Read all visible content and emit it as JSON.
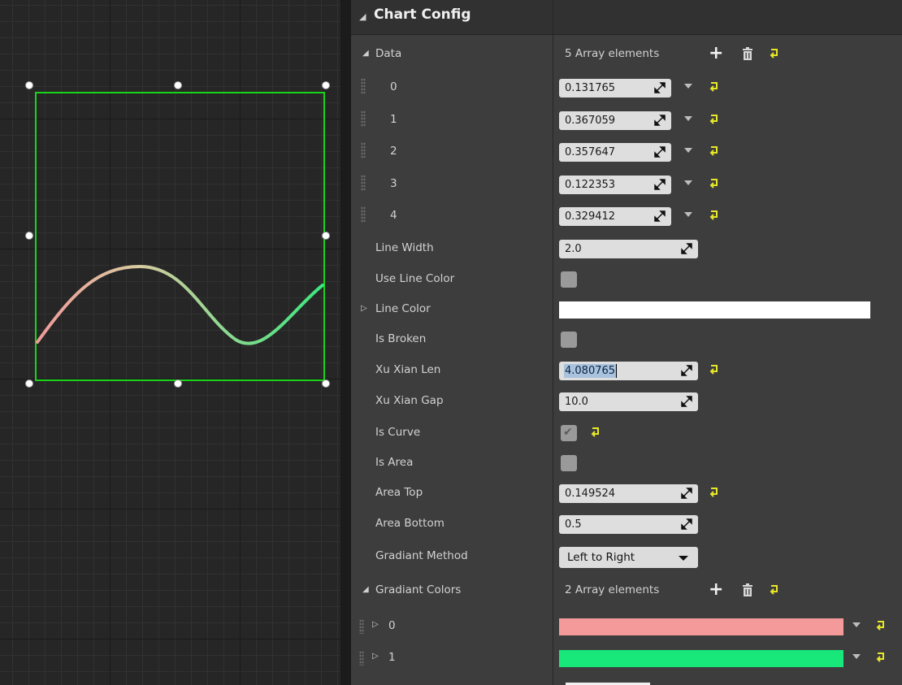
{
  "panel": {
    "section_title": "Chart Config",
    "data_label": "Data",
    "data_count": "5 Array elements",
    "data": [
      {
        "index": "0",
        "value": "0.131765"
      },
      {
        "index": "1",
        "value": "0.367059"
      },
      {
        "index": "2",
        "value": "0.357647"
      },
      {
        "index": "3",
        "value": "0.122353"
      },
      {
        "index": "4",
        "value": "0.329412"
      }
    ],
    "line_width": {
      "label": "Line Width",
      "value": "2.0"
    },
    "use_line_color": {
      "label": "Use Line Color",
      "checked": false
    },
    "line_color": {
      "label": "Line Color",
      "color": "#ffffff"
    },
    "is_broken": {
      "label": "Is Broken",
      "checked": false
    },
    "xu_xian_len": {
      "label": "Xu Xian Len",
      "value": "4.080765"
    },
    "xu_xian_gap": {
      "label": "Xu Xian Gap",
      "value": "10.0"
    },
    "is_curve": {
      "label": "Is Curve",
      "checked": true
    },
    "is_area": {
      "label": "Is Area",
      "checked": false
    },
    "area_top": {
      "label": "Area Top",
      "value": "0.149524"
    },
    "area_bottom": {
      "label": "Area Bottom",
      "value": "0.5"
    },
    "gradiant_method": {
      "label": "Gradiant Method",
      "value": "Left to Right"
    },
    "gradiant_colors_label": "Gradiant Colors",
    "gradiant_colors_count": "2 Array elements",
    "gradiant_colors": [
      {
        "index": "0",
        "color": "#f59a9a"
      },
      {
        "index": "1",
        "color": "#18e87a"
      }
    ]
  },
  "icons": {
    "add": "plus-icon",
    "delete": "trash-icon",
    "reset": "reset-to-default-icon",
    "spin": "spin-arrows-icon",
    "dropdown": "chevron-down-icon"
  },
  "preview": {
    "frame_color": "#19d419",
    "gradient_start": "#f09a9a",
    "gradient_end": "#3ae87e"
  }
}
